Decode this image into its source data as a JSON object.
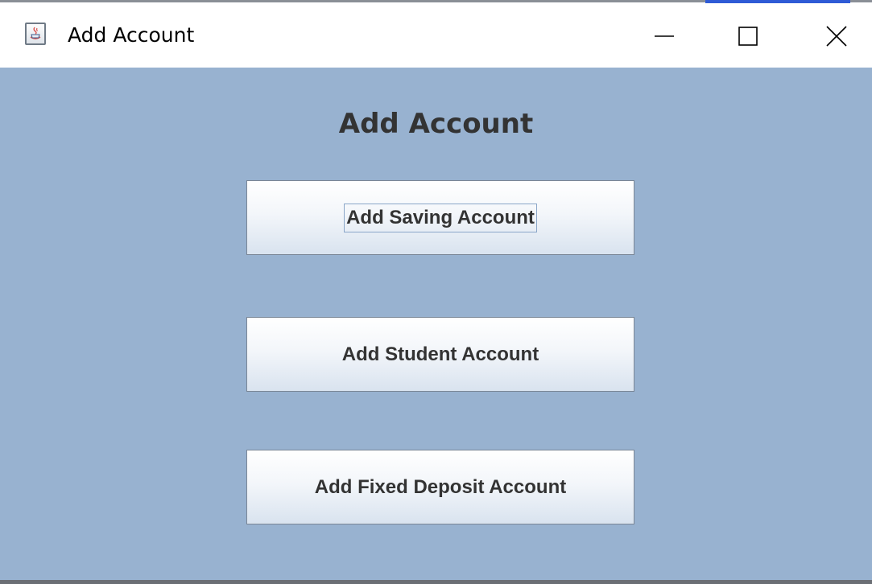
{
  "window": {
    "title": "Add Account",
    "icon": "java-coffee-cup-icon",
    "controls": {
      "minimize_icon": "minimize-icon",
      "maximize_icon": "maximize-icon",
      "close_icon": "close-icon"
    }
  },
  "main": {
    "heading": "Add Account",
    "buttons": [
      {
        "label": "Add Saving Account",
        "focused": true
      },
      {
        "label": "Add Student Account",
        "focused": false
      },
      {
        "label": "Add Fixed Deposit Account",
        "focused": false
      }
    ]
  },
  "colors": {
    "panel_background": "#98b2d0",
    "heading_text": "#333333",
    "button_text": "#333333",
    "titlebar_background": "#ffffff",
    "accent": "#2f5bd6"
  }
}
